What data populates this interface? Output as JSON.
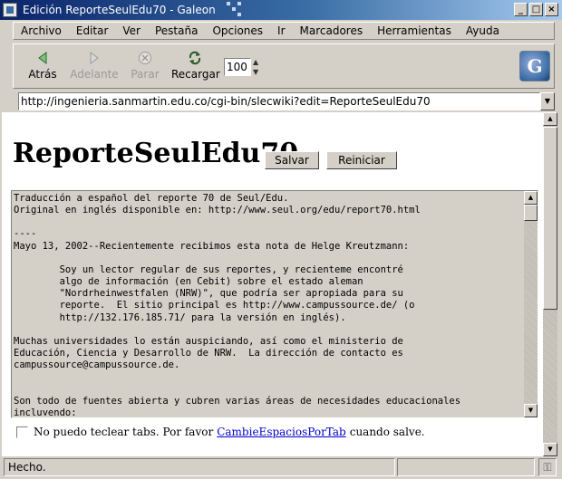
{
  "window": {
    "title": "Edición ReporteSeulEdu70 - Galeon"
  },
  "menu": [
    "Archivo",
    "Editar",
    "Ver",
    "Pestaña",
    "Opciones",
    "Ir",
    "Marcadores",
    "Herramientas",
    "Ayuda"
  ],
  "toolbar": {
    "back_label": "Atrás",
    "forward_label": "Adelante",
    "stop_label": "Parar",
    "reload_label": "Recargar",
    "zoom_value": "100"
  },
  "url": "http://ingenieria.sanmartin.edu.co/cgi-bin/slecwiki?edit=ReporteSeulEdu70",
  "page": {
    "title": "ReporteSeulEdu70",
    "save_label": "Salvar",
    "reset_label": "Reiniciar",
    "textarea_content": "Traducción a español del reporte 70 de Seul/Edu.\nOriginal en inglés disponible en: http://www.seul.org/edu/report70.html\n\n----\nMayo 13, 2002--Recientemente recibimos esta nota de Helge Kreutzmann:\n\n        Soy un lector regular de sus reportes, y recienteme encontré\n        algo de información (en Cebit) sobre el estado aleman\n        \"Nordrheinwestfalen (NRW)\", que podría ser apropiada para su\n        reporte.  El sitio principal es http://www.campussource.de/ (o\n        http://132.176.185.71/ para la versión en inglés).\n\nMuchas universidades lo están auspiciando, así como el ministerio de\nEducación, Ciencia y Desarrollo de NRW.  La dirección de contacto es\ncampussource@campussource.de.\n\n\nSon todo de fuentes abierta y cubren varias áreas de necesidades educacionales\nincluyendo:",
    "tabs_note_before": "No puedo teclear tabs. Por favor",
    "tabs_note_link": "CambieEspaciosPorTab",
    "tabs_note_after": "cuando salve."
  },
  "status": {
    "text": "Hecho."
  }
}
